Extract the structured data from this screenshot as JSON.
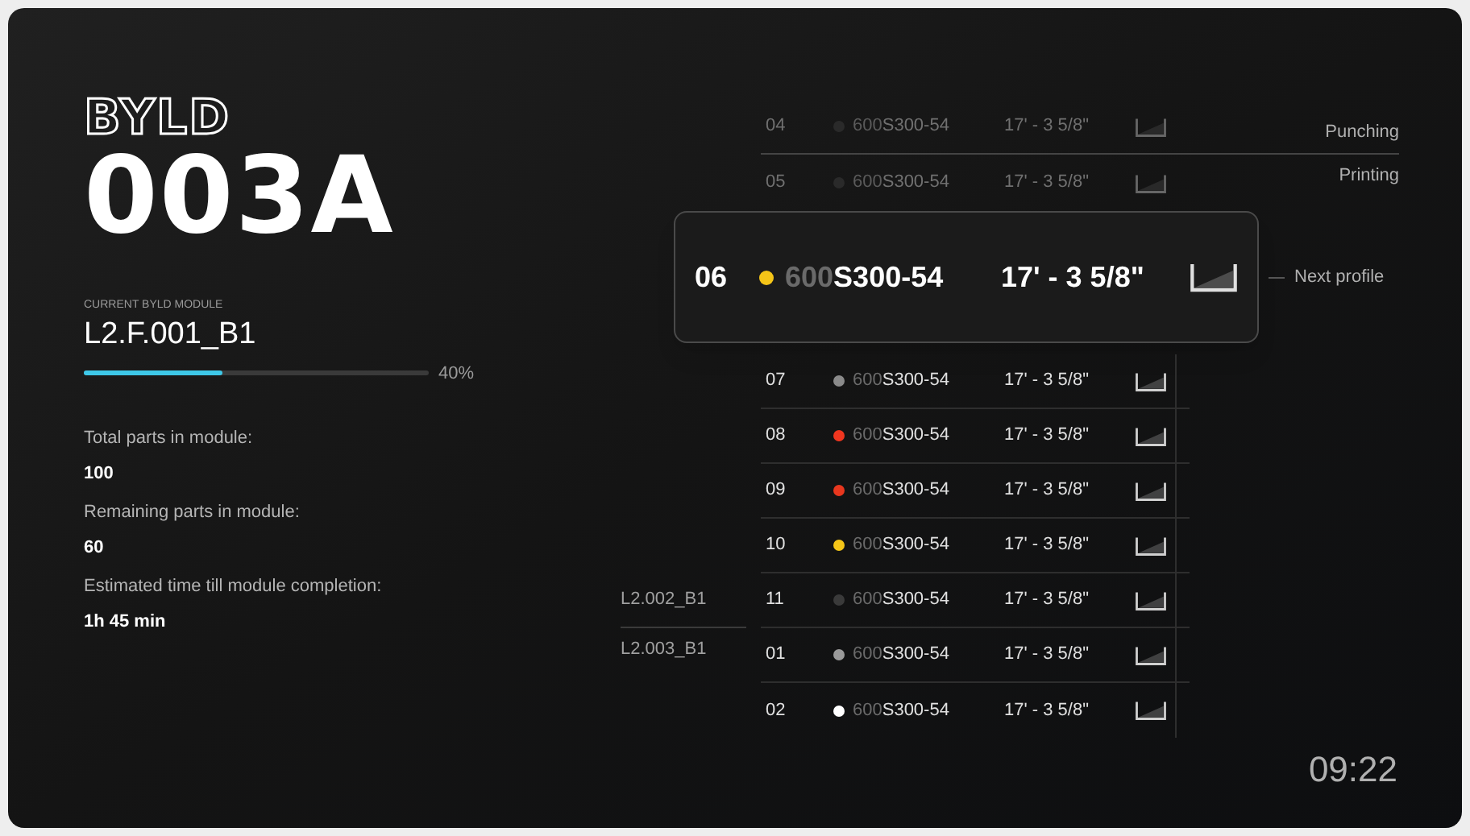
{
  "brand": "BYLD",
  "station": "003A",
  "module": {
    "caption": "CURRENT BYLD MODULE",
    "name": "L2.F.001_B1",
    "level": 0.4,
    "percent": "40%"
  },
  "stats": [
    {
      "label": "Total parts in module:",
      "value": "100"
    },
    {
      "label": "Remaining parts in module:",
      "value": "60"
    },
    {
      "label": "Estimated time till module completion:",
      "value": "1h 45 min"
    }
  ],
  "rows": [
    {
      "kind": "done",
      "number": "04",
      "color": "#2a2a2a",
      "code_prefix": "600",
      "code": "S300-54",
      "length": "17' - 3 5/8\"",
      "side_label": "Punching"
    },
    {
      "kind": "done",
      "number": "05",
      "color": "#2a2a2a",
      "code_prefix": "600",
      "code": "S300-54",
      "length": "17' - 3 5/8\"",
      "side_label": "Printing"
    },
    {
      "kind": "current",
      "number": "06",
      "color": "#f5c518",
      "code_prefix": "600",
      "code": "S300-54",
      "length": "17' - 3 5/8\"",
      "side_label": "Next profile"
    },
    {
      "kind": "queued",
      "number": "07",
      "color": "#8a8a8a",
      "code_prefix": "600",
      "code": "S300-54",
      "length": "17' - 3 5/8\""
    },
    {
      "kind": "queued",
      "number": "08",
      "color": "#f0361f",
      "code_prefix": "600",
      "code": "S300-54",
      "length": "17' - 3 5/8\""
    },
    {
      "kind": "queued",
      "number": "09",
      "color": "#e8371e",
      "code_prefix": "600",
      "code": "S300-54",
      "length": "17' - 3 5/8\""
    },
    {
      "kind": "queued",
      "number": "10",
      "color": "#f5c518",
      "code_prefix": "600",
      "code": "S300-54",
      "length": "17' - 3 5/8\""
    },
    {
      "kind": "queued",
      "number": "11",
      "color": "#3a3a3a",
      "code_prefix": "600",
      "code": "S300-54",
      "length": "17' - 3 5/8\"",
      "module_label": "L2.002_B1"
    },
    {
      "kind": "queued",
      "number": "01",
      "color": "#9a9a9a",
      "code_prefix": "600",
      "code": "S300-54",
      "length": "17' - 3 5/8\"",
      "module_label": "L2.003_B1"
    },
    {
      "kind": "queued",
      "number": "02",
      "color": "#ffffff",
      "code_prefix": "600",
      "code": "S300-54",
      "length": "17' - 3 5/8\""
    }
  ],
  "clock": "09:22"
}
